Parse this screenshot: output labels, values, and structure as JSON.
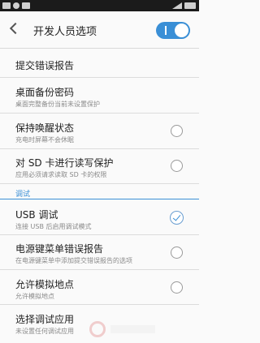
{
  "app_bar": {
    "title": "开发人员选项",
    "master_switch_on": true
  },
  "items": [
    {
      "title": "提交错误报告",
      "subtitle": ""
    },
    {
      "title": "桌面备份密码",
      "subtitle": "桌面完整备份当前未设置保护"
    },
    {
      "title": "保持唤醒状态",
      "subtitle": "充电时屏幕不会休眠",
      "checked": false
    },
    {
      "title": "对 SD 卡进行读写保护",
      "subtitle": "应用必须请求读取 SD 卡的权限",
      "checked": false
    }
  ],
  "section": {
    "label": "调试"
  },
  "debug_items": [
    {
      "title": "USB 调试",
      "subtitle": "连接 USB 后启用调试模式",
      "checked": true
    },
    {
      "title": "电源键菜单错误报告",
      "subtitle": "在电源键菜单中添加提交错误报告的选项",
      "checked": false
    },
    {
      "title": "允许模拟地点",
      "subtitle": "允许模拟地点",
      "checked": false
    },
    {
      "title": "选择调试应用",
      "subtitle": "未设置任何调试应用"
    }
  ]
}
